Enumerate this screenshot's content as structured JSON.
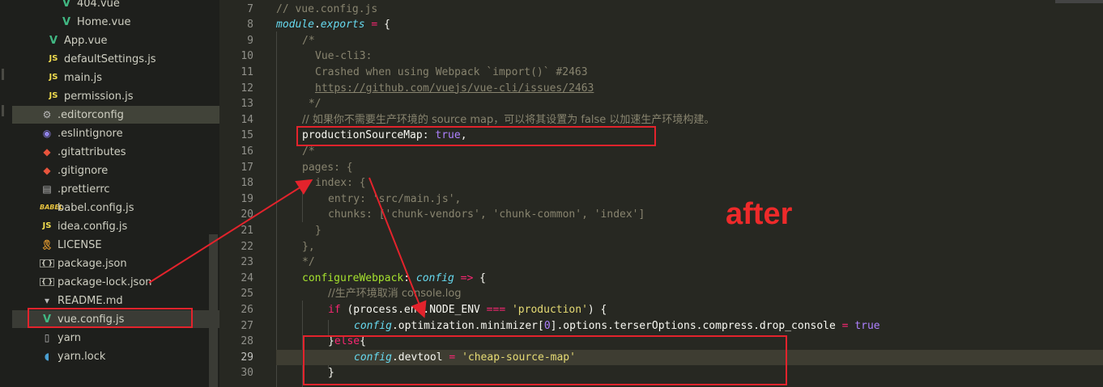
{
  "sidebar": {
    "items": [
      {
        "name": "404.vue",
        "icon": "vue-icon",
        "indent": 58
      },
      {
        "name": "Home.vue",
        "icon": "vue-icon",
        "indent": 58
      },
      {
        "name": "App.vue",
        "icon": "vue-icon",
        "indent": 42
      },
      {
        "name": "defaultSettings.js",
        "icon": "js-icon",
        "indent": 42
      },
      {
        "name": "main.js",
        "icon": "js-icon",
        "indent": 42
      },
      {
        "name": "permission.js",
        "icon": "js-icon",
        "indent": 42
      },
      {
        "name": ".editorconfig",
        "icon": "editorconfig-icon",
        "indent": 34
      },
      {
        "name": ".eslintignore",
        "icon": "eslint-icon",
        "indent": 34
      },
      {
        "name": ".gitattributes",
        "icon": "git-icon",
        "indent": 34
      },
      {
        "name": ".gitignore",
        "icon": "git-icon",
        "indent": 34
      },
      {
        "name": ".prettierrc",
        "icon": "prettier-icon",
        "indent": 34
      },
      {
        "name": "babel.config.js",
        "icon": "babel-icon",
        "indent": 34
      },
      {
        "name": "idea.config.js",
        "icon": "js-icon",
        "indent": 34
      },
      {
        "name": "LICENSE",
        "icon": "license-icon",
        "indent": 34
      },
      {
        "name": "package.json",
        "icon": "json-icon",
        "indent": 34
      },
      {
        "name": "package-lock.json",
        "icon": "json-icon",
        "indent": 34
      },
      {
        "name": "README.md",
        "icon": "markdown-icon",
        "indent": 34
      },
      {
        "name": "vue.config.js",
        "icon": "vue-config-icon",
        "indent": 34
      },
      {
        "name": "yarn",
        "icon": "file-icon",
        "indent": 34
      },
      {
        "name": "yarn.lock",
        "icon": "yarn-icon",
        "indent": 34
      }
    ],
    "active_index": 6,
    "selected_index": 17
  },
  "editor": {
    "line_numbers": [
      "7",
      "8",
      "9",
      "10",
      "11",
      "12",
      "13",
      "14",
      "15",
      "16",
      "17",
      "18",
      "19",
      "20",
      "21",
      "22",
      "23",
      "24",
      "25",
      "26",
      "27",
      "28",
      "29",
      "30"
    ],
    "current_line": "29"
  },
  "code": {
    "l7": "// vue.config.js",
    "l8_module": "module",
    "l8_dot": ".",
    "l8_exports": "exports",
    "l8_eq": " = ",
    "l8_brace": "{",
    "l9": "/*",
    "l10": "Vue-cli3:",
    "l11": "Crashed when using Webpack `import()` #2463",
    "l12": "https://github.com/vuejs/vue-cli/issues/2463",
    "l13": " */",
    "l14": "// 如果你不需要生产环境的 source map，可以将其设置为 false 以加速生产环境构建。",
    "l15_key": "productionSourceMap",
    "l15_colon": ": ",
    "l15_val": "true",
    "l15_comma": ",",
    "l16": "/*",
    "l17": "pages: {",
    "l18": "index: {",
    "l19": "entry: 'src/main.js',",
    "l20": "chunks: ['chunk-vendors', 'chunk-common', 'index']",
    "l21": "}",
    "l22": "},",
    "l23": "*/",
    "l24_fn": "configureWebpack",
    "l24_colon": ": ",
    "l24_param": "config",
    "l24_arrow": " => ",
    "l24_brace": "{",
    "l25": "//生产环境取消 console.log",
    "l26_if": "if",
    "l26_open": " (process.env.NODE_ENV ",
    "l26_op": "===",
    "l26_sp": " ",
    "l26_str": "'production'",
    "l26_close": ") {",
    "l27_config": "config",
    "l27_mid": ".optimization.minimizer[",
    "l27_zero": "0",
    "l27_rest": "].options.terserOptions.compress.drop_console ",
    "l27_eq": "=",
    "l27_sp": " ",
    "l27_true": "true",
    "l28_brace": "}",
    "l28_else": "else",
    "l28_open": "{",
    "l29_config": "config",
    "l29_mid": ".devtool ",
    "l29_eq": "=",
    "l29_sp": " ",
    "l29_str": "'cheap-source-map'",
    "l30": "}"
  },
  "annotation": {
    "label": "after",
    "color": "#e3232c"
  },
  "colors": {
    "background": "#272822",
    "sidebar": "#1e1f1c",
    "keyword": "#f92672",
    "string": "#e6db74",
    "comment": "#88846f",
    "function": "#a6e22e",
    "number": "#ae81ff",
    "param": "#66d9ef"
  }
}
